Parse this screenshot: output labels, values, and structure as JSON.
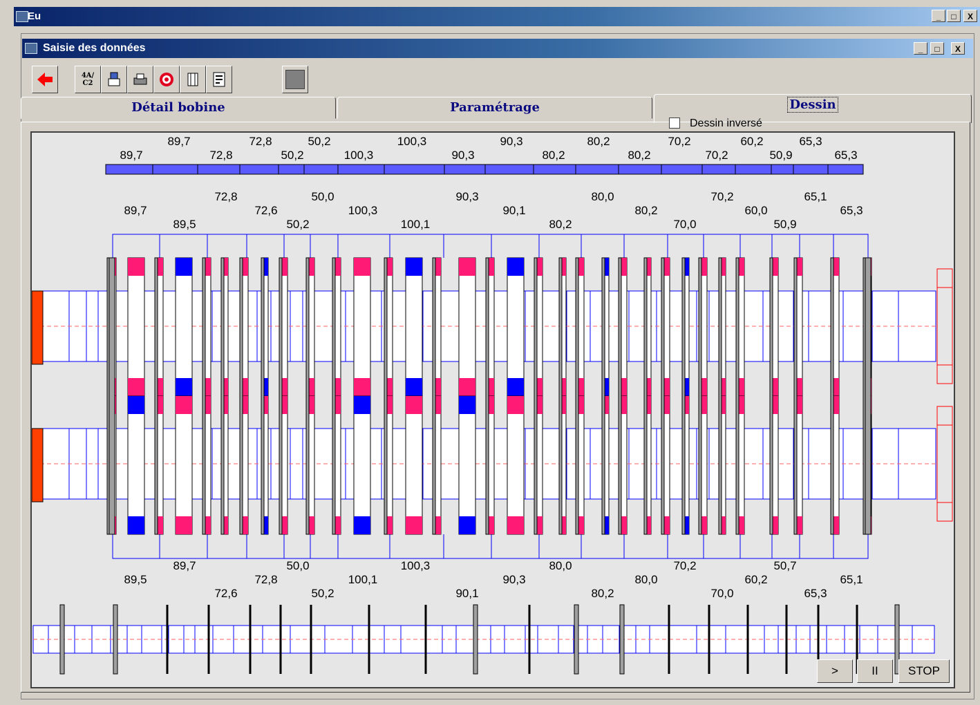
{
  "app": {
    "window_title": "Eu",
    "window_buttons": [
      "_",
      "□",
      "X"
    ]
  },
  "child_window": {
    "title": "Saisie des données",
    "window_buttons": [
      "_",
      "□",
      "X"
    ]
  },
  "toolbar": {
    "icons": [
      "back-arrow-icon",
      "conversion-icon",
      "paste-icon",
      "printer-icon",
      "target-icon",
      "roll-icon",
      "list-icon",
      "gray-square-icon"
    ],
    "conversion_label": "4A/C2"
  },
  "tabs": [
    {
      "label": "Détail bobine",
      "active": false
    },
    {
      "label": "Paramétrage",
      "active": false
    },
    {
      "label": "Dessin",
      "active": true
    }
  ],
  "options": {
    "dessin_inverse_label": "Dessin inversé",
    "dessin_inverse_checked": false
  },
  "drawing": {
    "top_bar_labels_row1": [
      "89,7",
      "72,8",
      "50,2",
      "100,3",
      "90,3",
      "80,2",
      "70,2",
      "60,2",
      "65,3"
    ],
    "top_bar_labels_row2": [
      "89,7",
      "72,8",
      "50,2",
      "100,3",
      "90,3",
      "80,2",
      "80,2",
      "70,2",
      "50,9",
      "65,3"
    ],
    "upper_labels_row1": [
      "72,8",
      "50,0",
      "90,3",
      "80,0",
      "70,2",
      "65,1"
    ],
    "upper_labels_row2": [
      "89,7",
      "72,6",
      "100,3",
      "90,1",
      "80,2",
      "60,0",
      "65,3"
    ],
    "upper_labels_row3": [
      "89,5",
      "50,2",
      "100,1",
      "80,2",
      "70,0",
      "50,9"
    ],
    "lower_labels_row1": [
      "89,7",
      "50,0",
      "100,3",
      "80,0",
      "70,2",
      "50,7"
    ],
    "lower_labels_row2": [
      "89,5",
      "72,8",
      "100,1",
      "90,3",
      "80,0",
      "60,2",
      "65,1"
    ],
    "lower_labels_row3": [
      "72,6",
      "50,2",
      "90,1",
      "80,2",
      "70,0",
      "65,3"
    ]
  },
  "playback": {
    "play_label": ">",
    "pause_label": "II",
    "stop_label": "STOP"
  },
  "colors": {
    "blue": "#0000ff",
    "magenta": "#ff1a75",
    "red": "#ff4000",
    "bar_blue": "#5a5aff"
  }
}
